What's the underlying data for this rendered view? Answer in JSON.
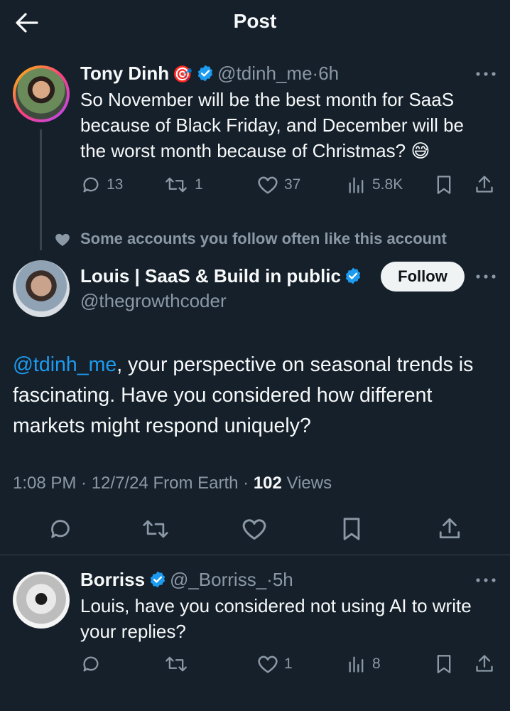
{
  "header": {
    "title": "Post",
    "back_icon": "arrow-left-icon"
  },
  "parent_post": {
    "name": "Tony Dinh",
    "badge_emoji": "🎯",
    "handle": "@tdinh_me",
    "time_sep": "·",
    "time": "6h",
    "text": "So November will be the best month for SaaS because of Black Friday, and December will be the worst month because of Christmas? 😅",
    "replies": "13",
    "reposts": "1",
    "likes": "37",
    "views": "5.8K"
  },
  "social_context": "Some accounts you follow often like this account",
  "main_post": {
    "name": "Louis | SaaS & Build in public",
    "handle": "@thegrowthcoder",
    "follow_label": "Follow",
    "mention": "@tdinh_me",
    "text": ", your perspective on seasonal trends is fascinating. Have you considered how different markets might respond uniquely?",
    "meta_time": "1:08 PM · 12/7/24 From Earth · ",
    "meta_views_count": "102",
    "meta_views_label": " Views"
  },
  "reply_post": {
    "name": "Borriss",
    "handle": "@_Borriss_",
    "time_sep": "·",
    "time": "5h",
    "text": "Louis, have you considered not using AI to write your replies?",
    "likes": "1",
    "views": "8"
  },
  "colors": {
    "background": "#15202b",
    "accent": "#1d9bf0",
    "muted": "#8b98a5",
    "divider": "#38444d"
  }
}
